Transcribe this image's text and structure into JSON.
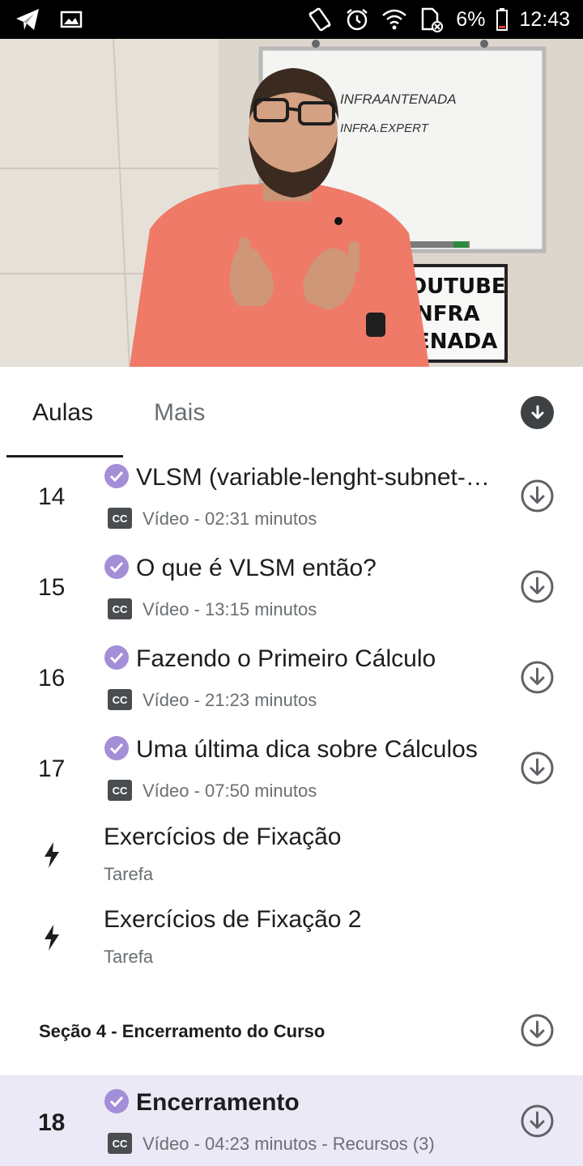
{
  "status_bar": {
    "battery": "6%",
    "time": "12:43",
    "icons": [
      "telegram-icon",
      "image-icon",
      "vibrate-icon",
      "alarm-icon",
      "wifi-icon",
      "sim-icon",
      "battery-icon"
    ]
  },
  "video": {
    "whiteboard_line1": "INFRAANTENADA",
    "whiteboard_line2": "INFRA.EXPERT",
    "lightbox_line1": "OUTUBE",
    "lightbox_line2": "NFRA",
    "lightbox_line3": "ENADA"
  },
  "tabs": {
    "aulas": "Aulas",
    "mais": "Mais"
  },
  "lessons": [
    {
      "num": "14",
      "title": "VLSM (variable-lenght-subnet-mask)",
      "meta": "Vídeo - 02:31 minutos",
      "cc": "CC"
    },
    {
      "num": "15",
      "title": "O que é VLSM então?",
      "meta": "Vídeo - 13:15 minutos",
      "cc": "CC"
    },
    {
      "num": "16",
      "title": "Fazendo o Primeiro Cálculo",
      "meta": "Vídeo - 21:23 minutos",
      "cc": "CC"
    },
    {
      "num": "17",
      "title": "Uma última dica sobre Cálculos",
      "meta": "Vídeo - 07:50 minutos",
      "cc": "CC"
    }
  ],
  "tasks": [
    {
      "title": "Exercícios de Fixação",
      "sub": "Tarefa"
    },
    {
      "title": "Exercícios de Fixação 2",
      "sub": "Tarefa"
    }
  ],
  "section": {
    "title": "Seção 4 - Encerramento do Curso"
  },
  "current_lesson": {
    "num": "18",
    "title": "Encerramento",
    "meta": "Vídeo - 04:23 minutos - Recursos (3)",
    "cc": "CC"
  },
  "colors": {
    "check": "#a38ed8",
    "active_row": "#ece9f6",
    "text": "#1c1d1f",
    "muted": "#6a6f73"
  }
}
